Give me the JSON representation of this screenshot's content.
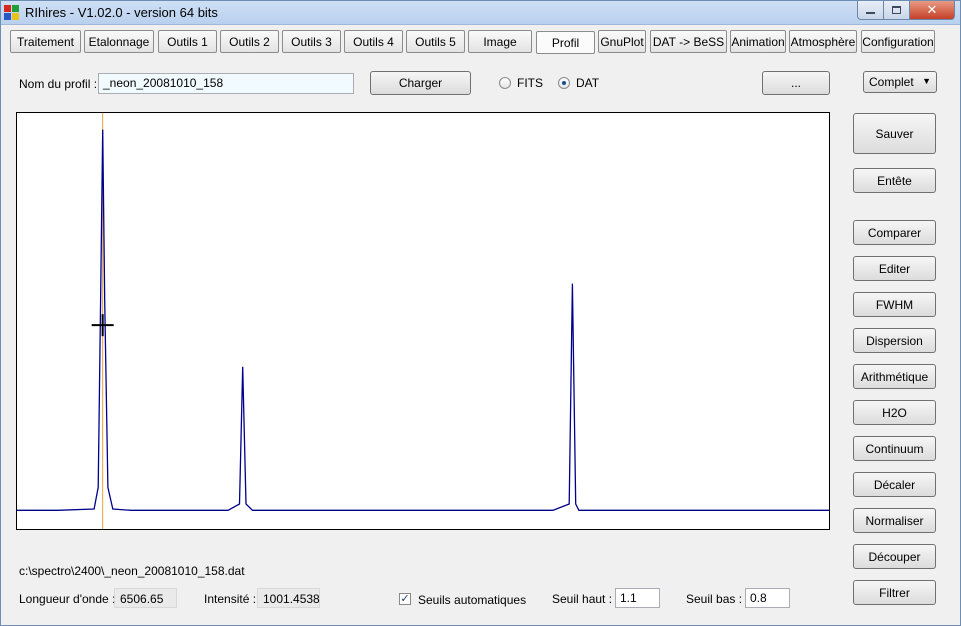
{
  "window": {
    "title": "RIhires - V1.02.0 - version 64 bits"
  },
  "tabs": [
    {
      "label": "Traitement"
    },
    {
      "label": "Etalonnage"
    },
    {
      "label": "Outils 1"
    },
    {
      "label": "Outils 2"
    },
    {
      "label": "Outils 3"
    },
    {
      "label": "Outils 4"
    },
    {
      "label": "Outils 5"
    },
    {
      "label": "Image"
    },
    {
      "label": "Profil",
      "selected": true
    },
    {
      "label": "GnuPlot"
    },
    {
      "label": "DAT -> BeSS"
    },
    {
      "label": "Animation"
    },
    {
      "label": "Atmosphère"
    },
    {
      "label": "Configuration"
    }
  ],
  "profile": {
    "name_label": "Nom du profil :",
    "name_value": "_neon_20081010_158",
    "load_button": "Charger",
    "format_fits": "FITS",
    "format_dat": "DAT",
    "selected_format": "DAT",
    "browse_button": "...",
    "mode_value": "Complet"
  },
  "side_buttons": {
    "save": "Sauver",
    "header": "Entête",
    "compare": "Comparer",
    "edit": "Editer",
    "fwhm": "FWHM",
    "dispersion": "Dispersion",
    "arithmetic": "Arithmétique",
    "h2o": "H2O",
    "continuum": "Continuum",
    "shift": "Décaler",
    "normalize": "Normaliser",
    "crop": "Découper",
    "filter": "Filtrer"
  },
  "status": {
    "file_path": "c:\\spectro\\2400\\_neon_20081010_158.dat",
    "wavelength_label": "Longueur d'onde :",
    "wavelength_value": "6506.65",
    "intensity_label": "Intensité :",
    "intensity_value": "1001.4538",
    "auto_thresholds_label": "Seuils automatiques",
    "auto_thresholds_checked": true,
    "high_threshold_label": "Seuil haut :",
    "high_threshold_value": "1.1",
    "low_threshold_label": "Seuil bas :",
    "low_threshold_value": "0.8"
  },
  "chart_data": {
    "type": "line",
    "x": [
      0,
      0.05,
      0.095,
      0.1,
      0.103,
      0.1055,
      0.108,
      0.112,
      0.118,
      0.14,
      0.26,
      0.274,
      0.278,
      0.282,
      0.29,
      0.32,
      0.66,
      0.68,
      0.684,
      0.688,
      0.692,
      0.7,
      0.73,
      1.0
    ],
    "values": [
      0.045,
      0.045,
      0.048,
      0.1,
      0.55,
      0.96,
      0.55,
      0.1,
      0.048,
      0.045,
      0.045,
      0.06,
      0.39,
      0.06,
      0.045,
      0.045,
      0.045,
      0.06,
      0.59,
      0.06,
      0.045,
      0.045,
      0.045,
      0.045
    ],
    "series_color": "#00008b",
    "cursor_color": "#e6a23c",
    "cursor_x": 0.1055,
    "crosshair": {
      "x": 0.1055,
      "y": 0.49
    },
    "grid": false
  }
}
